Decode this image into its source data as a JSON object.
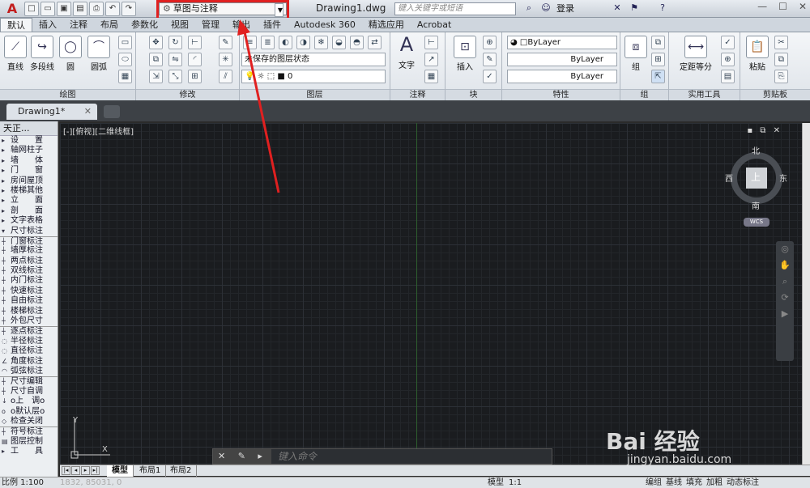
{
  "titlebar": {
    "app_logo": "A",
    "workspace": "草图与注释",
    "title": "Drawing1.dwg",
    "search_placeholder": "键入关键字或短语",
    "login": "登录",
    "qat_icons": [
      "new-icon",
      "open-icon",
      "save-icon",
      "saveas-icon",
      "print-icon",
      "undo-icon",
      "redo-icon"
    ],
    "accent_color": "#e02020"
  },
  "ribbon_tabs": [
    "默认",
    "插入",
    "注释",
    "布局",
    "参数化",
    "视图",
    "管理",
    "输出",
    "插件",
    "Autodesk 360",
    "精选应用",
    "Acrobat"
  ],
  "ribbon": {
    "draw": {
      "title": "绘图",
      "items": [
        "直线",
        "多段线",
        "圆",
        "圆弧"
      ]
    },
    "modify": {
      "title": "修改"
    },
    "layer": {
      "title": "图层",
      "state": "未保存的图层状态",
      "current": "0"
    },
    "annotation": {
      "title": "注释",
      "text": "文字"
    },
    "block": {
      "title": "块",
      "insert": "插入"
    },
    "properties": {
      "title": "特性",
      "color": "ByLayer",
      "linetype": "ByLayer",
      "lineweight": "ByLayer"
    },
    "groups": {
      "title": "组",
      "group": "组"
    },
    "utilities": {
      "title": "实用工具",
      "measure": "定距等分"
    },
    "clipboard": {
      "title": "剪贴板",
      "paste": "粘贴"
    }
  },
  "doc_tab": {
    "label": "Drawing1*",
    "close": "✕"
  },
  "palette": {
    "title": "天正...",
    "items": [
      "设　　置",
      "轴网柱子",
      "墙　　体",
      "门　　窗",
      "房间屋顶",
      "楼梯其他",
      "立　　面",
      "剖　　面",
      "文字表格",
      "尺寸标注",
      "门窗标注",
      "墙厚标注",
      "两点标注",
      "双线标注",
      "内门标注",
      "快速标注",
      "自由标注",
      "楼梯标注",
      "外包尺寸",
      "逐点标注",
      "半径标注",
      "直径标注",
      "角度标注",
      "弧弦标注",
      "尺寸编辑",
      "尺寸自调",
      "o上　调o",
      "o默认层o",
      "检查关闭",
      "符号标注",
      "图层控制",
      "工　　具"
    ]
  },
  "viewport": {
    "label": "[-][俯视][二维线框]",
    "compass": {
      "n": "北",
      "s": "南",
      "e": "东",
      "w": "西",
      "top": "上"
    },
    "wcs": "WCS",
    "ucs_x": "X",
    "ucs_y": "Y"
  },
  "command": {
    "placeholder": "键入命令"
  },
  "layout_tabs": [
    "模型",
    "布局1",
    "布局2"
  ],
  "status": {
    "scale": "比例 1:100",
    "coords": "1832, 85031, 0",
    "model": "模型",
    "anno_scale": "1:1",
    "buttons": [
      "编组",
      "基线",
      "填充",
      "加粗",
      "动态标注"
    ]
  },
  "watermark": {
    "brand": "Bai 经验",
    "url": "jingyan.baidu.com"
  }
}
